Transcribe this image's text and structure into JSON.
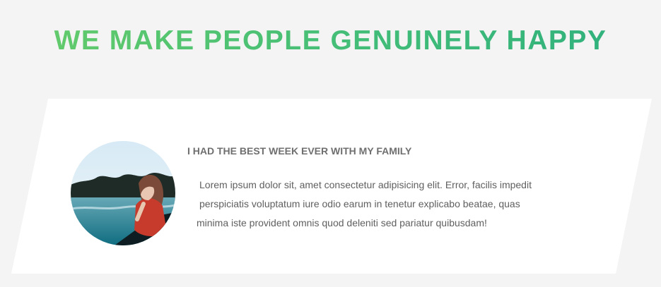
{
  "hero": {
    "title": "WE MAKE PEOPLE GENUINELY HAPPY"
  },
  "testimonial": {
    "title": "I HAD THE BEST WEEK EVER WITH MY FAMILY",
    "body_lines": [
      "Lorem ipsum dolor sit, amet consectetur adipisicing elit. Error, facilis impedit",
      "perspiciatis voluptatum iure odio earum in tenetur explicabo beatae, quas",
      "minima iste provident omnis quod deleniti sed pariatur quibusdam!"
    ]
  },
  "colors": {
    "page_background": "#f4f4f4",
    "card_background": "#ffffff",
    "title_green_start": "#66cc6a",
    "title_green_end": "#2eaf7d",
    "text_gray": "#5f5f5f"
  },
  "media": {
    "avatar_icon": "person-avatar-icon"
  }
}
